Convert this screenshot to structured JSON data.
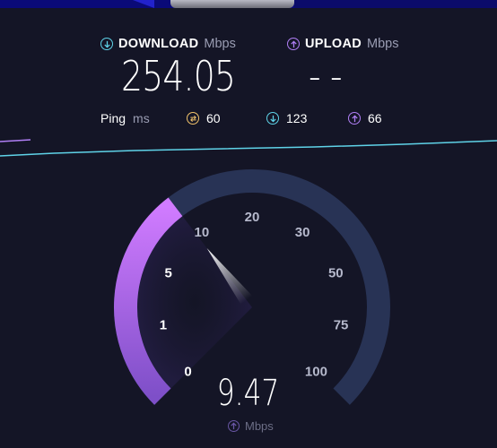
{
  "download": {
    "label": "DOWNLOAD",
    "unit": "Mbps",
    "value": "254.05",
    "icon": "arrow-down-circle-icon"
  },
  "upload": {
    "label": "UPLOAD",
    "unit": "Mbps",
    "value": "- -",
    "icon": "arrow-up-circle-icon"
  },
  "ping": {
    "label": "Ping",
    "unit": "ms",
    "idle": {
      "value": "60",
      "icon": "jitter-icon"
    },
    "download": {
      "value": "123",
      "icon": "arrow-down-circle-icon"
    },
    "upload": {
      "value": "66",
      "icon": "arrow-up-circle-icon"
    }
  },
  "gauge": {
    "ticks": [
      "0",
      "1",
      "5",
      "10",
      "20",
      "30",
      "50",
      "75",
      "100"
    ],
    "current_value": "9.47",
    "current_unit": "Mbps",
    "needle_value": 9.47,
    "colors": {
      "track": "#283355",
      "fill_start": "#7e4fc8",
      "fill_end": "#d07bff"
    }
  },
  "colors": {
    "background": "#141526",
    "download_accent": "#5fd3e8",
    "upload_accent": "#b07ff5",
    "jitter_accent": "#f1c26b"
  }
}
